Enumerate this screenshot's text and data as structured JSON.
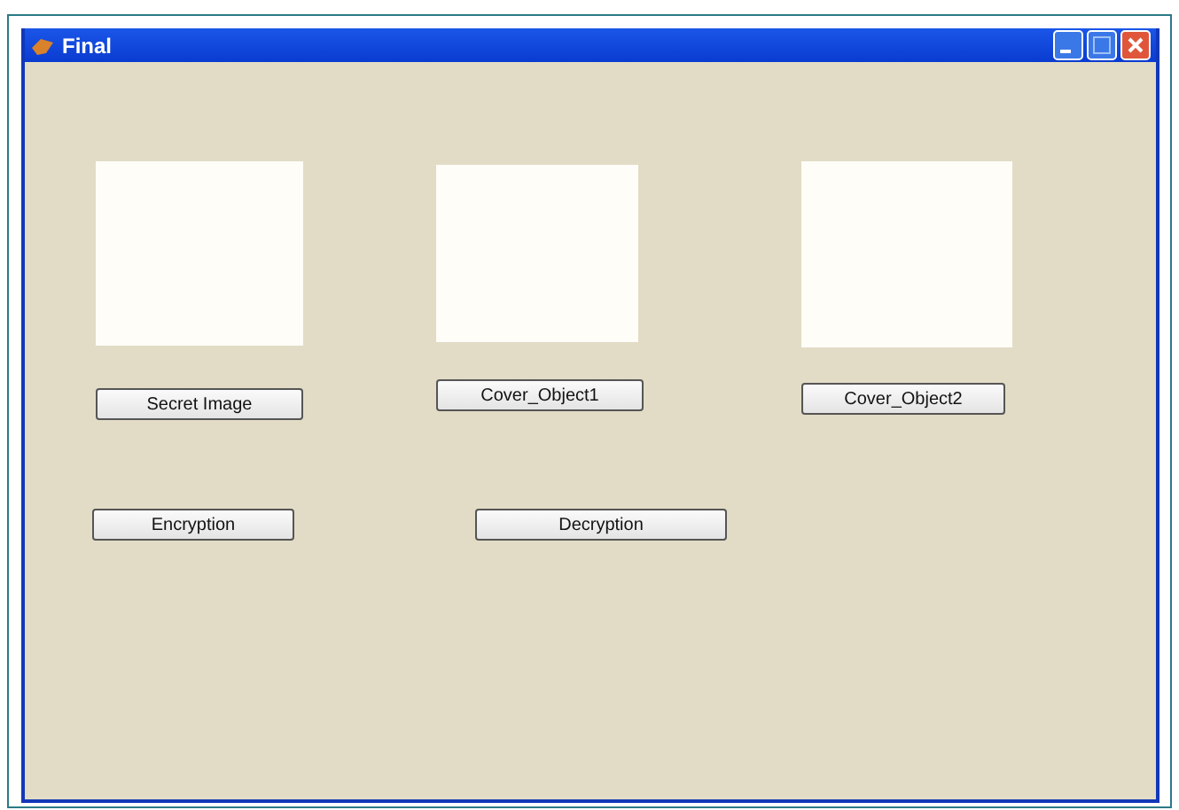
{
  "window": {
    "title": "Final"
  },
  "image_panels": [
    {
      "button": "Secret Image"
    },
    {
      "button": "Cover_Object1"
    },
    {
      "button": "Cover_Object2"
    }
  ],
  "actions": [
    "Encryption",
    "Decryption"
  ]
}
